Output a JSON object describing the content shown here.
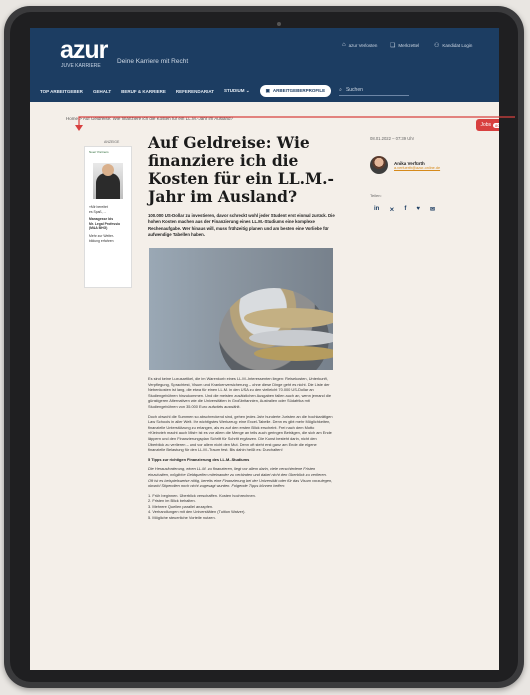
{
  "site": {
    "logo": "azur",
    "logo_sub": "JUVE KARRIERE",
    "tagline": "Deine Karriere mit Recht"
  },
  "utility_nav": [
    {
      "icon": "graduation-icon",
      "label": "azur Verlosten"
    },
    {
      "icon": "bookmark-icon",
      "label": "Merkzettel"
    },
    {
      "icon": "user-icon",
      "label": "Kandidat Login"
    }
  ],
  "main_nav": [
    "TOP ARBEITGEBER",
    "GEHALT",
    "BERUF & KARRIERE",
    "REFERENDARIAT",
    "STUDIUM"
  ],
  "nav_button": "ARBEITGEBERPROFILE",
  "search": {
    "placeholder": "Suchen"
  },
  "breadcrumb": "Home > Auf Geldreise: Wie finanziere ich die Kosten für ein LL.M.-Jahr im Ausland?",
  "jobs": {
    "label": "Jobs",
    "count": "80"
  },
  "ad": {
    "label": "ANZEIGE",
    "brand": "Noerr Partners",
    "text": [
      "»Mir bereitet",
      "es Spaß, ...",
      "Managesse bis",
      "Mr. Legal Professio",
      "(M&A BHG)",
      "Mehr zur Weiter-",
      "bildung erfahren"
    ]
  },
  "article": {
    "title": "Auf Geldreise: Wie finanziere ich die Kosten für ein LL.M.-Jahr im Ausland?",
    "lead": "100.000 US-Dollar zu investieren, davor schreckt wohl jeder Student erst einmal zurück. Die hohen Kosten machen aus der Finanzierung eines LL.M.-Studiums eine komplexe Rechenaufgabe. Wer hinaus will, muss frühzeitig planen und am besten eine Vorliebe für aufwendige Tabellen haben.",
    "paragraphs": [
      "Es sind keine Luxusartikel, die im Warenkorb eines LL.M.-Interessenten liegen: Reisekosten, Unterkunft, Verpflegung, Sprachtest, Visum und Krankenversicherung – ohne diese Dinge geht es nicht. Die Liste der Nebenkosten ist lang, die etwa für einen LL.M. in den USA zu den vielleicht 70.000 US-Dollar an Studiengebühren hinzukommen. Und die meisten zusätzlichen Ausgaben fallen auch an, wenn jemand die günstigeren Alternativen wie die Universitäten in Großbritannien, Australien oder Südafrika mit Studiengebühren von 35.000 Euro aufwärts auswählt.",
      "Doch obwohl die Summen so abschreckend sind, gehen jedes Jahr hunderte Juristen an die hochkarätigen Law Schools in aller Welt. Ihr wichtigstes Werkzeug: eine Excel-Tabelle. Denn es gibt mehr Möglichkeiten, finanzielle Unterstützung zu erlangen, als es auf den ersten Blick erscheint. Frei nach dem Motto »Kleinvieh macht auch Mist« ist es vor allem die Menge an teils auch geringen Beträgen, die sich am Ende läppern und den Finanzierungsplan Schritt für Schritt ergänzen. Die Kunst besteht darin, nicht den Überblick zu verlieren – und vor allem nicht den Mut. Denn oft steht erst ganz am Ende die eigene finanzielle Belastung für den LL.M.-Traum fest. Bis dahin heißt es: Durchalten!"
    ],
    "subheading": "5 Tipps zur richtigen Finanzierung des LL.M.-Studiums",
    "italic": "Die Herausforderung, einen LL.M. zu finanzieren, liegt vor allem darin, viele verschiedene Fristen einzuhalten, mögliche Geldquellen miteinander zu verbinden und dabei nicht den Überblick zu verlieren. Oft ist es beispielsweise nötig, bereits eine Finanzierung bei der Universität oder für das Visum vorzulegen, obwohl Stipendien noch nicht zugesagt wurden. Folgende Tipps können helfen:",
    "tips": [
      "1. Früh beginnen. Überblick verschaffen. Kosten hochrechnen.",
      "2. Fristen im Blick behalten.",
      "3. Mehrere Quellen parallel anzapfen.",
      "4. Verhandlungen mit den Universitäten (Tuition Waiver).",
      "5. Mögliche steuerliche Vorteile nutzen."
    ]
  },
  "sidebar": {
    "date": "08.01.2022 – 07:39 Uhr",
    "author_name": "Anika Verfürth",
    "author_email": "a.verfuerth@azur-online.de",
    "share_label": "Teilen:",
    "share": [
      {
        "icon": "linkedin-icon",
        "glyph": "in"
      },
      {
        "icon": "xing-icon",
        "glyph": "⨯"
      },
      {
        "icon": "facebook-icon",
        "glyph": "f"
      },
      {
        "icon": "twitter-icon",
        "glyph": "♥"
      },
      {
        "icon": "mail-icon",
        "glyph": "✉"
      }
    ]
  },
  "colors": {
    "header": "#1c3d62",
    "accent": "#d8403f",
    "background": "#f4efe9"
  }
}
